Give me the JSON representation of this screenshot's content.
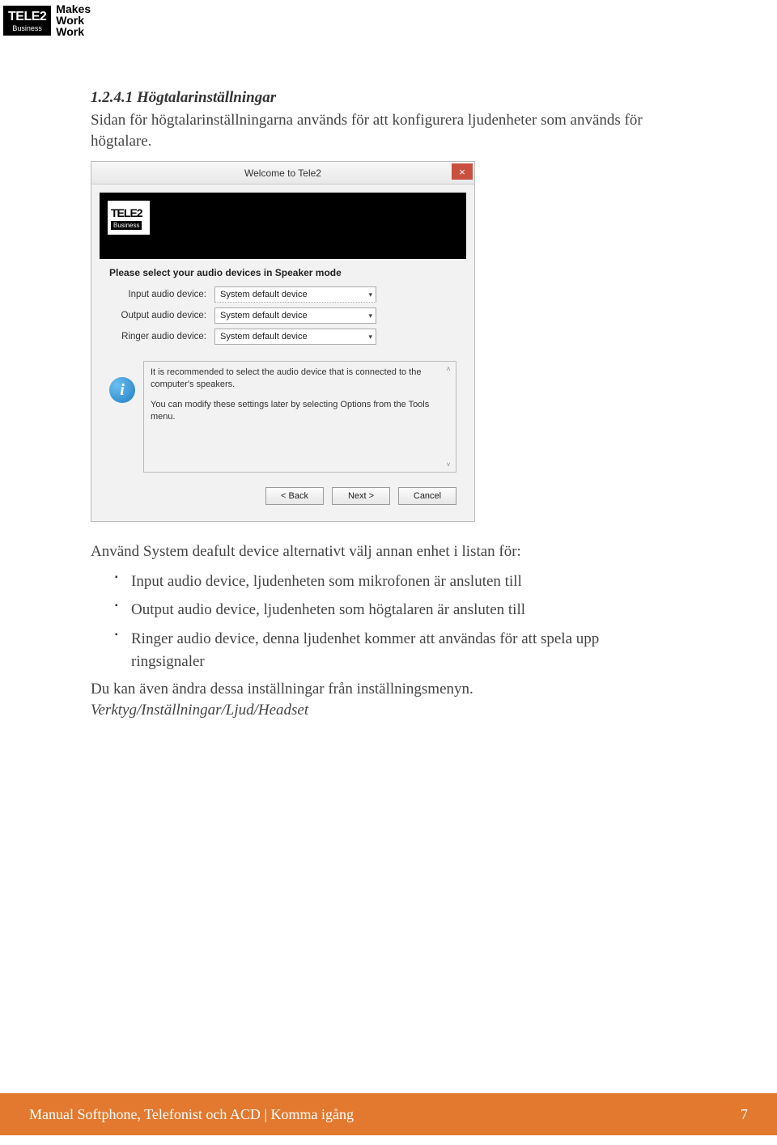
{
  "header": {
    "logo_main": "TELE2",
    "logo_sub": "Business",
    "tagline_l1": "Makes",
    "tagline_l2": "Work",
    "tagline_l3": "Work"
  },
  "section": {
    "heading": "1.2.4.1 Högtalarinställningar",
    "intro": "Sidan för högtalarinställningarna används för att konfigurera ljudenheter som används för högtalare."
  },
  "dialog": {
    "title": "Welcome to Tele2",
    "close": "×",
    "badge_main": "TELE2",
    "badge_sub": "Business",
    "prompt": "Please select your audio devices in Speaker mode",
    "rows": [
      {
        "label": "Input audio device:",
        "value": "System default device"
      },
      {
        "label": "Output audio device:",
        "value": "System default device"
      },
      {
        "label": "Ringer audio device:",
        "value": "System default device"
      }
    ],
    "info1": "It is recommended to select the audio device that is connected to the computer's speakers.",
    "info2": "You can modify these settings later by selecting Options from the Tools menu.",
    "info_glyph": "i",
    "buttons": {
      "back": "< Back",
      "next": "Next >",
      "cancel": "Cancel"
    }
  },
  "post": {
    "lead": "Använd System deafult device alternativt välj annan enhet i listan för:",
    "bullets": [
      "Input audio device, ljudenheten som mikrofonen är ansluten till",
      "Output audio device, ljudenheten som högtalaren är ansluten till",
      "Ringer audio device, denna ljudenhet kommer att användas för att spela upp ringsignaler"
    ],
    "outro1": "Du kan även ändra dessa inställningar från inställningsmenyn.",
    "outro2": "Verktyg/Inställningar/Ljud/Headset"
  },
  "footer": {
    "left": "Manual Softphone, Telefonist och ACD | Komma igång",
    "page": "7"
  }
}
